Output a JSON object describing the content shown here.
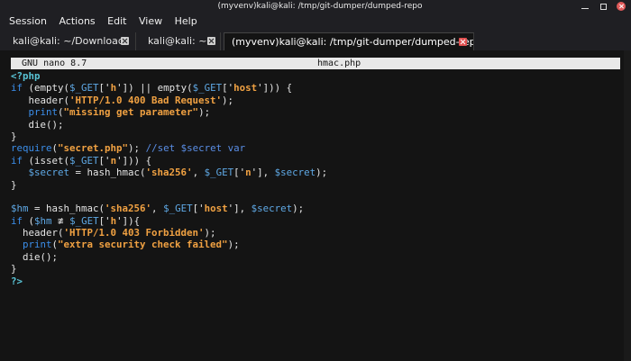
{
  "window": {
    "title": "(myvenv)kali@kali: /tmp/git-dumper/dumped-repo"
  },
  "menu": [
    "Session",
    "Actions",
    "Edit",
    "View",
    "Help"
  ],
  "tabs": [
    {
      "label": "kali@kali: ~/Downloads",
      "active": false
    },
    {
      "label": "kali@kali: ~",
      "active": false
    },
    {
      "label": "(myvenv)kali@kali: /tmp/git-dumper/dumped-repo",
      "active": true
    }
  ],
  "nano": {
    "version": "GNU nano 8.7",
    "filename": "hmac.php"
  },
  "code_lines": [
    [
      {
        "t": "<?php",
        "c": "tag"
      }
    ],
    [
      {
        "t": "if",
        "c": "kw"
      },
      {
        "t": " (empty(",
        "c": "plain"
      },
      {
        "t": "$_GET",
        "c": "var"
      },
      {
        "t": "['",
        "c": "plain"
      },
      {
        "t": "h",
        "c": "str"
      },
      {
        "t": "']) || empty(",
        "c": "plain"
      },
      {
        "t": "$_GET",
        "c": "var"
      },
      {
        "t": "['",
        "c": "plain"
      },
      {
        "t": "host",
        "c": "str"
      },
      {
        "t": "'])) {",
        "c": "plain"
      }
    ],
    [
      {
        "t": "   header(",
        "c": "plain"
      },
      {
        "t": "'HTTP/1.0 400 Bad Request'",
        "c": "str"
      },
      {
        "t": ");",
        "c": "plain"
      }
    ],
    [
      {
        "t": "   ",
        "c": "plain"
      },
      {
        "t": "print",
        "c": "kw"
      },
      {
        "t": "(",
        "c": "plain"
      },
      {
        "t": "\"missing get parameter\"",
        "c": "str"
      },
      {
        "t": ");",
        "c": "plain"
      }
    ],
    [
      {
        "t": "   die();",
        "c": "plain"
      }
    ],
    [
      {
        "t": "}",
        "c": "plain"
      }
    ],
    [
      {
        "t": "require",
        "c": "kw"
      },
      {
        "t": "(",
        "c": "plain"
      },
      {
        "t": "\"secret.php\"",
        "c": "str"
      },
      {
        "t": "); ",
        "c": "plain"
      },
      {
        "t": "//set $secret var",
        "c": "cmt"
      }
    ],
    [
      {
        "t": "if",
        "c": "kw"
      },
      {
        "t": " (isset(",
        "c": "plain"
      },
      {
        "t": "$_GET",
        "c": "var"
      },
      {
        "t": "['",
        "c": "plain"
      },
      {
        "t": "n",
        "c": "str"
      },
      {
        "t": "'])) {",
        "c": "plain"
      }
    ],
    [
      {
        "t": "   ",
        "c": "plain"
      },
      {
        "t": "$secret",
        "c": "var"
      },
      {
        "t": " = hash_hmac(",
        "c": "plain"
      },
      {
        "t": "'sha256'",
        "c": "str"
      },
      {
        "t": ", ",
        "c": "plain"
      },
      {
        "t": "$_GET",
        "c": "var"
      },
      {
        "t": "['",
        "c": "plain"
      },
      {
        "t": "n",
        "c": "str"
      },
      {
        "t": "'], ",
        "c": "plain"
      },
      {
        "t": "$secret",
        "c": "var"
      },
      {
        "t": ");",
        "c": "plain"
      }
    ],
    [
      {
        "t": "}",
        "c": "plain"
      }
    ],
    [
      {
        "t": "",
        "c": "plain"
      }
    ],
    [
      {
        "t": "$hm",
        "c": "var"
      },
      {
        "t": " = hash_hmac(",
        "c": "plain"
      },
      {
        "t": "'sha256'",
        "c": "str"
      },
      {
        "t": ", ",
        "c": "plain"
      },
      {
        "t": "$_GET",
        "c": "var"
      },
      {
        "t": "['",
        "c": "plain"
      },
      {
        "t": "host",
        "c": "str"
      },
      {
        "t": "'], ",
        "c": "plain"
      },
      {
        "t": "$secret",
        "c": "var"
      },
      {
        "t": ");",
        "c": "plain"
      }
    ],
    [
      {
        "t": "if",
        "c": "kw"
      },
      {
        "t": " (",
        "c": "plain"
      },
      {
        "t": "$hm",
        "c": "var"
      },
      {
        "t": " ≢ ",
        "c": "plain"
      },
      {
        "t": "$_GET",
        "c": "var"
      },
      {
        "t": "['",
        "c": "plain"
      },
      {
        "t": "h",
        "c": "str"
      },
      {
        "t": "']){",
        "c": "plain"
      }
    ],
    [
      {
        "t": "  header(",
        "c": "plain"
      },
      {
        "t": "'HTTP/1.0 403 Forbidden'",
        "c": "str"
      },
      {
        "t": ");",
        "c": "plain"
      }
    ],
    [
      {
        "t": "  ",
        "c": "plain"
      },
      {
        "t": "print",
        "c": "kw"
      },
      {
        "t": "(",
        "c": "plain"
      },
      {
        "t": "\"extra security check failed\"",
        "c": "str"
      },
      {
        "t": ");",
        "c": "plain"
      }
    ],
    [
      {
        "t": "  die();",
        "c": "plain"
      }
    ],
    [
      {
        "t": "}",
        "c": "plain"
      }
    ],
    [
      {
        "t": "?>",
        "c": "tag"
      }
    ]
  ]
}
